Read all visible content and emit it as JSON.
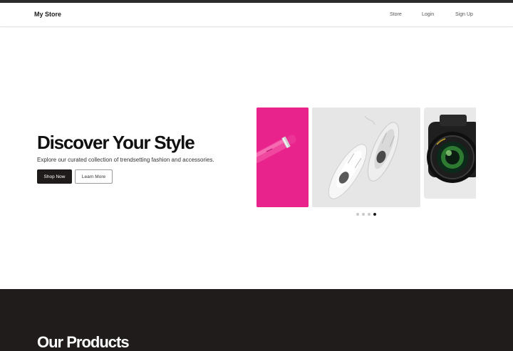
{
  "navbar": {
    "brand": "My Store",
    "links": [
      "Store",
      "Login",
      "Sign Up"
    ]
  },
  "hero": {
    "title": "Discover Your Style",
    "subtitle": "Explore our curated collection of trendsetting fashion and accessories.",
    "primary_button": "Shop Now",
    "secondary_button": "Learn More"
  },
  "carousel": {
    "slides": [
      "lipstick-image",
      "sneakers-image",
      "camera-image"
    ],
    "dot_count": 4,
    "active_dot": 4
  },
  "products": {
    "title": "Our Products"
  },
  "colors": {
    "dark": "#1e1b1a",
    "accent_pink": "#e8238c"
  }
}
